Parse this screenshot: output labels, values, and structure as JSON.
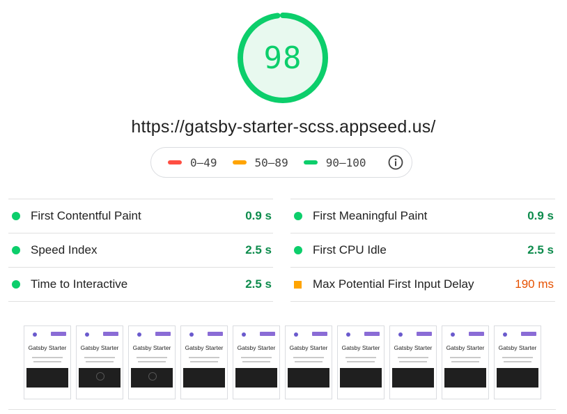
{
  "score": {
    "value": "98",
    "fraction": 0.98,
    "color": "#0cce6b",
    "background": "#e8f9ef"
  },
  "url": "https://gatsby-starter-scss.appseed.us/",
  "legend": {
    "items": [
      {
        "range": "0–49",
        "color": "#ff4e42"
      },
      {
        "range": "50–89",
        "color": "#ffa400"
      },
      {
        "range": "90–100",
        "color": "#0cce6b"
      }
    ],
    "info_icon": "info-icon"
  },
  "metrics": {
    "left": [
      {
        "label": "First Contentful Paint",
        "value": "0.9 s",
        "status": "pass"
      },
      {
        "label": "Speed Index",
        "value": "2.5 s",
        "status": "pass"
      },
      {
        "label": "Time to Interactive",
        "value": "2.5 s",
        "status": "pass"
      }
    ],
    "right": [
      {
        "label": "First Meaningful Paint",
        "value": "0.9 s",
        "status": "pass"
      },
      {
        "label": "First CPU Idle",
        "value": "2.5 s",
        "status": "pass"
      },
      {
        "label": "Max Potential First Input Delay",
        "value": "190 ms",
        "status": "average"
      }
    ]
  },
  "filmstrip": {
    "frames": [
      {
        "title": "Gatsby Starter",
        "spinner": false
      },
      {
        "title": "Gatsby Starter",
        "spinner": true
      },
      {
        "title": "Gatsby Starter",
        "spinner": true
      },
      {
        "title": "Gatsby Starter",
        "spinner": false
      },
      {
        "title": "Gatsby Starter",
        "spinner": false
      },
      {
        "title": "Gatsby Starter",
        "spinner": false
      },
      {
        "title": "Gatsby Starter",
        "spinner": false
      },
      {
        "title": "Gatsby Starter",
        "spinner": false
      },
      {
        "title": "Gatsby Starter",
        "spinner": false
      },
      {
        "title": "Gatsby Starter",
        "spinner": false
      }
    ]
  }
}
